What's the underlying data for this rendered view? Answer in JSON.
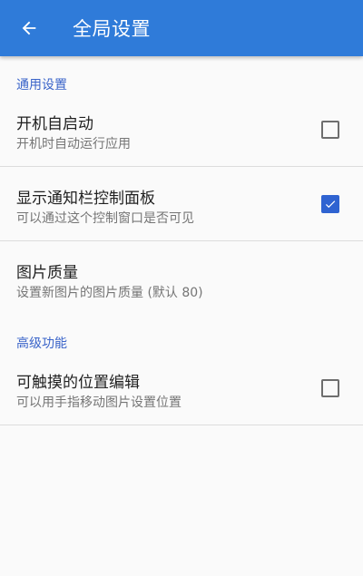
{
  "appbar": {
    "back_icon": "arrow-back-icon",
    "title": "全局设置",
    "color": "#2f7bd9"
  },
  "sections": [
    {
      "header": "通用设置",
      "items": [
        {
          "title": "开机自启动",
          "summary": "开机时自动运行应用",
          "checkbox": false
        },
        {
          "title": "显示通知栏控制面板",
          "summary": "可以通过这个控制窗口是否可见",
          "checkbox": true
        },
        {
          "title": "图片质量",
          "summary": "设置新图片的图片质量 (默认 80)"
        }
      ]
    },
    {
      "header": "高级功能",
      "items": [
        {
          "title": "可触摸的位置编辑",
          "summary": "可以用手指移动图片设置位置",
          "checkbox": false
        }
      ]
    }
  ],
  "colors": {
    "accent": "#2f63d1",
    "section_header": "#3a64c9"
  }
}
